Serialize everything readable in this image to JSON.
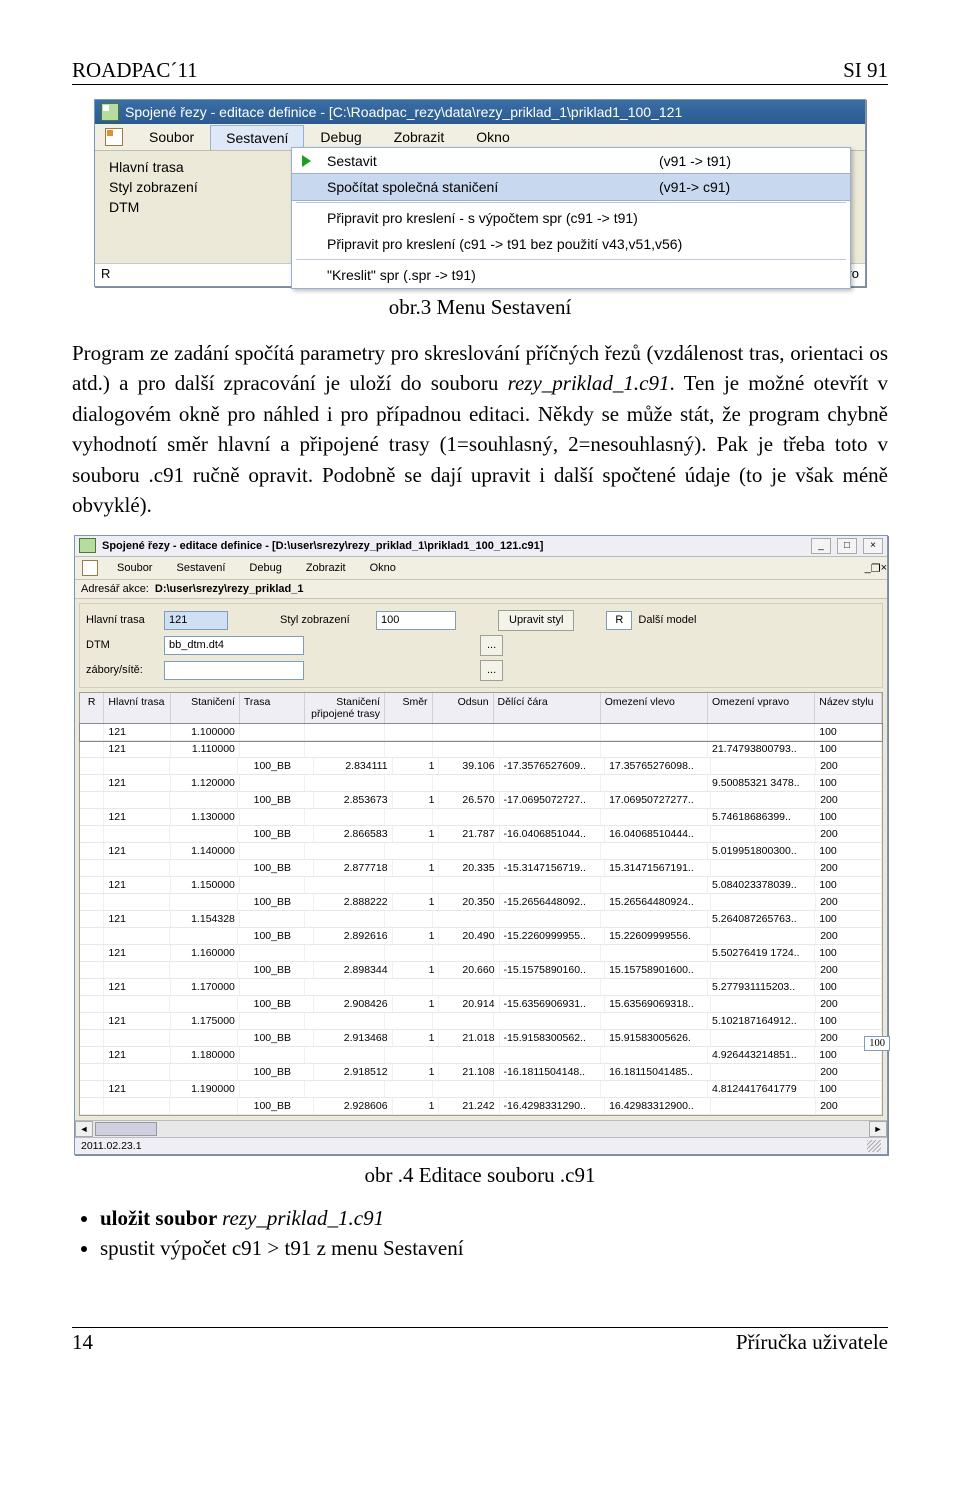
{
  "header": {
    "left": "ROADPAC´11",
    "right": "SI 91"
  },
  "caption1": "obr.3 Menu Sestavení",
  "paragraph": "Program ze zadání spočítá parametry pro skreslování příčných řezů (vzdálenost tras, orientaci os atd.) a pro další zpracování je uloží do souboru rezy_priklad_1.c91. Ten je možné otevřít v dialogovém okně pro náhled i pro případnou editaci. Někdy se může stát, že program chybně vyhodnotí směr hlavní a připojené trasy (1=souhlasný, 2=nesouhlasný). Pak je třeba toto v souboru .c91 ručně opravit.  Podobně se dají upravit i další spočtené údaje (to je však méně obvyklé).",
  "caption2": "obr .4 Editace souboru .c91",
  "bullets": [
    "uložit soubor rezy_priklad_1.c91",
    "spustit  výpočet  c91 > t91 z menu Sestavení"
  ],
  "bullet1_bold": "uložit soubor ",
  "bullet1_ital": "rezy_priklad_1.c91",
  "footer": {
    "left": "14",
    "right": "Příručka uživatele"
  },
  "s1": {
    "title": "Spojené řezy - editace definice - [C:\\Roadpac_rezy\\data\\rezy_priklad_1\\priklad1_100_121",
    "menu": [
      "Soubor",
      "Sestavení",
      "Debug",
      "Zobrazit",
      "Okno"
    ],
    "form": [
      "Hlavní trasa",
      "Styl zobrazení",
      "DTM"
    ],
    "dd": [
      {
        "l": "Sestavit",
        "r": "(v91 -> t91)",
        "play": true
      },
      {
        "l": "Spočítat společná staničení",
        "r": "(v91-> c91)",
        "hl": true
      },
      {
        "l": "Připravit pro kreslení - s výpočtem spr (c91 -> t91)",
        "r": ""
      },
      {
        "l": "Připravit pro kreslení (c91 -> t91 bez použití v43,v51,v56)",
        "r": ""
      },
      {
        "l": "\"Kreslit\" spr (.spr -> t91)",
        "r": ""
      }
    ],
    "clipL": "R",
    "clipR": "ro"
  },
  "s2": {
    "title": "Spojené řezy - editace definice - [D:\\user\\srezy\\rezy_priklad_1\\priklad1_100_121.c91]",
    "menu": [
      "Soubor",
      "Sestavení",
      "Debug",
      "Zobrazit",
      "Okno"
    ],
    "dirLabel": "Adresář akce:",
    "dir": "D:\\user\\srezy\\rezy_priklad_1",
    "hl": {
      "lblHlavni": "Hlavní trasa",
      "valHlavni": "121",
      "lblStyl": "Styl zobrazení",
      "valStyl": "100",
      "btnUprav": "Upravit styl",
      "lblR": "R",
      "lblDalsi": "Další model",
      "lblDTM": "DTM",
      "valDTM": "bb_dtm.dt4",
      "btnDots": "...",
      "lblZabory": "zábory/sítě:",
      "valZabory": ""
    },
    "cols": [
      "R",
      "Hlavní trasa",
      "Staničení",
      "Trasa",
      "Staničení připojené trasy",
      "Směr",
      "Odsun",
      "Dělící čára",
      "Omezení vlevo",
      "Omezení vpravo",
      "Název stylu"
    ],
    "rows": [
      [
        "",
        "121",
        "1.100000",
        "",
        "",
        "",
        "",
        "",
        "",
        "",
        "100"
      ],
      [
        "",
        "121",
        "1.110000",
        "",
        "",
        "",
        "",
        "",
        "",
        "21.74793800793..",
        "100"
      ],
      [
        "",
        "",
        "",
        "100_BB",
        "2.834111",
        "1",
        "39.106",
        "-17.3576527609..",
        "17.35765276098..",
        "",
        "200"
      ],
      [
        "",
        "121",
        "1.120000",
        "",
        "",
        "",
        "",
        "",
        "",
        "9.50085321 3478..",
        "100"
      ],
      [
        "",
        "",
        "",
        "100_BB",
        "2.853673",
        "1",
        "26.570",
        "-17.0695072727..",
        "17.06950727277..",
        "",
        "200"
      ],
      [
        "",
        "121",
        "1.130000",
        "",
        "",
        "",
        "",
        "",
        "",
        "5.74618686399..",
        "100"
      ],
      [
        "",
        "",
        "",
        "100_BB",
        "2.866583",
        "1",
        "21.787",
        "-16.0406851044..",
        "16.04068510444..",
        "",
        "200"
      ],
      [
        "",
        "121",
        "1.140000",
        "",
        "",
        "",
        "",
        "",
        "",
        "5.019951800300..",
        "100"
      ],
      [
        "",
        "",
        "",
        "100_BB",
        "2.877718",
        "1",
        "20.335",
        "-15.3147156719..",
        "15.31471567191..",
        "",
        "200"
      ],
      [
        "",
        "121",
        "1.150000",
        "",
        "",
        "",
        "",
        "",
        "",
        "5.084023378039..",
        "100"
      ],
      [
        "",
        "",
        "",
        "100_BB",
        "2.888222",
        "1",
        "20.350",
        "-15.2656448092..",
        "15.26564480924..",
        "",
        "200"
      ],
      [
        "",
        "121",
        "1.154328",
        "",
        "",
        "",
        "",
        "",
        "",
        "5.264087265763..",
        "100"
      ],
      [
        "",
        "",
        "",
        "100_BB",
        "2.892616",
        "1",
        "20.490",
        "-15.2260999955..",
        "15.22609999556.",
        "",
        "200"
      ],
      [
        "",
        "121",
        "1.160000",
        "",
        "",
        "",
        "",
        "",
        "",
        "5.50276419 1724..",
        "100"
      ],
      [
        "",
        "",
        "",
        "100_BB",
        "2.898344",
        "1",
        "20.660",
        "-15.1575890160..",
        "15.15758901600..",
        "",
        "200"
      ],
      [
        "",
        "121",
        "1.170000",
        "",
        "",
        "",
        "",
        "",
        "",
        "5.277931115203..",
        "100"
      ],
      [
        "",
        "",
        "",
        "100_BB",
        "2.908426",
        "1",
        "20.914",
        "-15.6356906931..",
        "15.63569069318..",
        "",
        "200"
      ],
      [
        "",
        "121",
        "1.175000",
        "",
        "",
        "",
        "",
        "",
        "",
        "5.102187164912..",
        "100"
      ],
      [
        "",
        "",
        "",
        "100_BB",
        "2.913468",
        "1",
        "21.018",
        "-15.9158300562..",
        "15.91583005626.",
        "",
        "200"
      ],
      [
        "",
        "121",
        "1.180000",
        "",
        "",
        "",
        "",
        "",
        "",
        "4.926443214851..",
        "100"
      ],
      [
        "",
        "",
        "",
        "100_BB",
        "2.918512",
        "1",
        "21.108",
        "-16.1811504148..",
        "16.18115041485..",
        "",
        "200"
      ],
      [
        "",
        "121",
        "1.190000",
        "",
        "",
        "",
        "",
        "",
        "",
        "4.8124417641779",
        "100"
      ],
      [
        "",
        "",
        "",
        "100_BB",
        "2.928606",
        "1",
        "21.242",
        "-16.4298331290..",
        "16.42983312900..",
        "",
        "200"
      ]
    ],
    "status": "2011.02.23.1",
    "float": "100"
  }
}
